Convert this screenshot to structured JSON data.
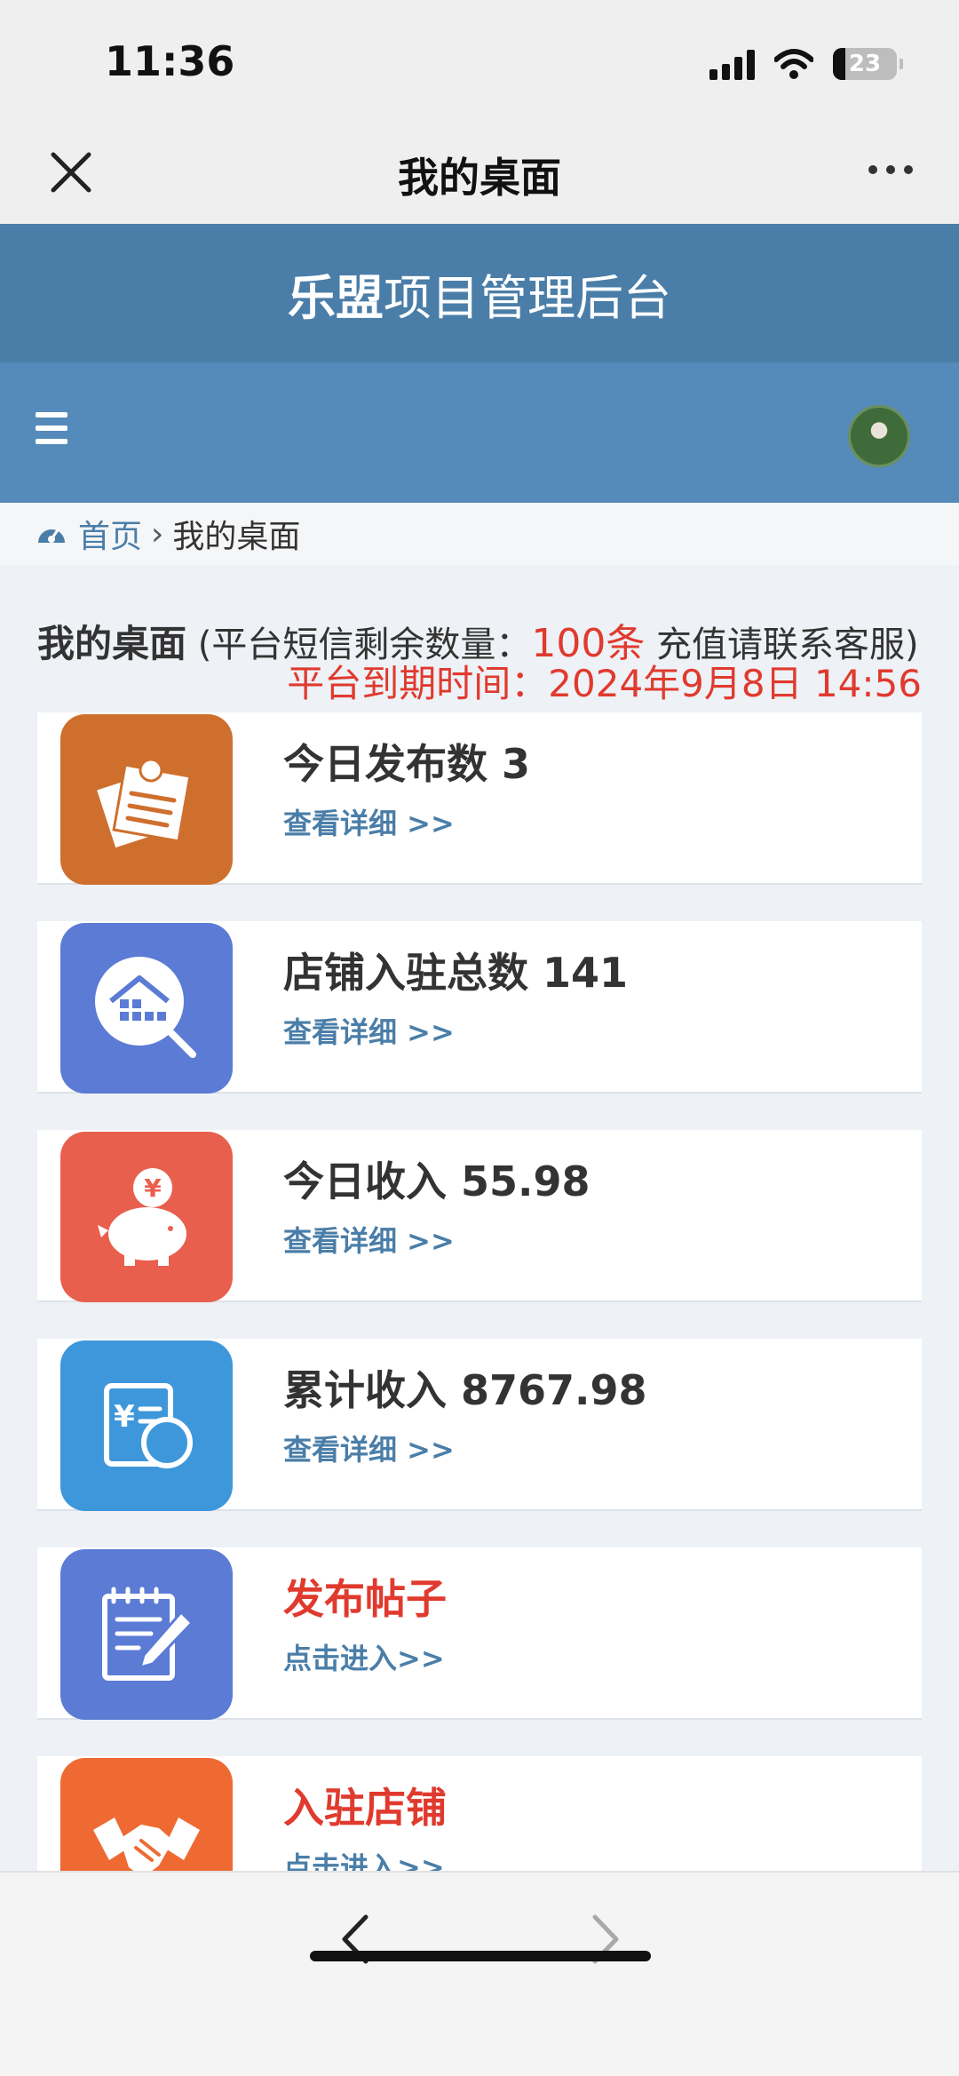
{
  "status_bar": {
    "time": "11:36",
    "battery": "23"
  },
  "nav_bar": {
    "title": "我的桌面"
  },
  "app_header": {
    "brand": "乐盟",
    "subtitle": "项目管理后台"
  },
  "breadcrumb": {
    "home": "首页",
    "separator": "›",
    "current": "我的桌面"
  },
  "desk": {
    "title": "我的桌面",
    "open_paren": " (",
    "sms_label": "平台短信剩余数量：",
    "sms_count": "100条",
    "contact": " 充值请联系客服)",
    "expire_label": "平台到期时间：",
    "expire_value": "2024年9月8日 14:56"
  },
  "cards": [
    {
      "title": "今日发布数 3",
      "link": "查看详细 >>",
      "icon": "notes-pin-icon",
      "color": "#cf6f2e"
    },
    {
      "title": "店铺入驻总数 141",
      "link": "查看详细 >>",
      "icon": "store-search-icon",
      "color": "#5b7bd5"
    },
    {
      "title": "今日收入 55.98",
      "link": "查看详细 >>",
      "icon": "piggy-bank-icon",
      "color": "#e95f4e"
    },
    {
      "title": "累计收入 8767.98",
      "link": "查看详细 >>",
      "icon": "ledger-coin-icon",
      "color": "#3e97db"
    },
    {
      "title": "发布帖子",
      "link": "点击进入>>",
      "icon": "edit-note-icon",
      "color": "#5b7bd5"
    },
    {
      "title": "入驻店铺",
      "link": "点击进入>>",
      "icon": "handshake-icon",
      "color": "#ef6a33"
    }
  ]
}
